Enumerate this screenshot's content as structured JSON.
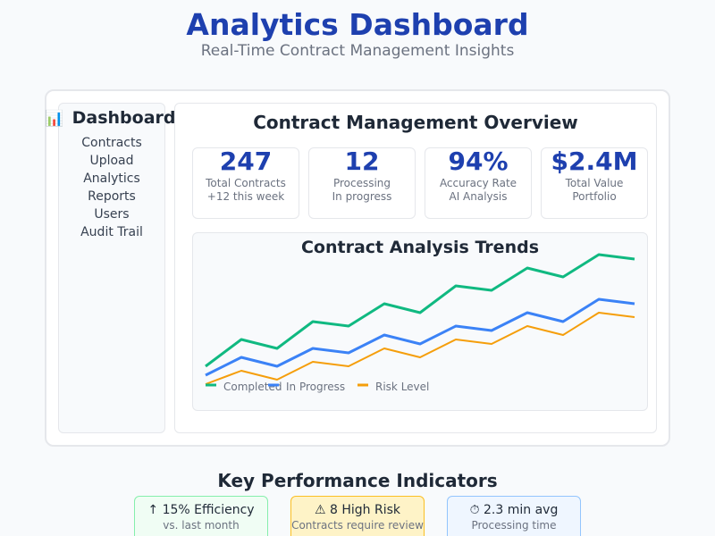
{
  "header": {
    "title": "Analytics Dashboard",
    "subtitle": "Real-Time Contract Management Insights"
  },
  "sidebar": {
    "title": "Dashboard",
    "title_icon": "📊",
    "items": [
      {
        "label": "Contracts"
      },
      {
        "label": "Upload"
      },
      {
        "label": "Analytics"
      },
      {
        "label": "Reports"
      },
      {
        "label": "Users"
      },
      {
        "label": "Audit Trail"
      }
    ]
  },
  "overview": {
    "title": "Contract Management Overview",
    "stats": [
      {
        "value": "247",
        "label": "Total Contracts",
        "sub": "+12 this week"
      },
      {
        "value": "12",
        "label": "Processing",
        "sub": "In progress"
      },
      {
        "value": "94%",
        "label": "Accuracy Rate",
        "sub": "AI Analysis"
      },
      {
        "value": "$2.4M",
        "label": "Total Value",
        "sub": "Portfolio"
      }
    ]
  },
  "chart_data": {
    "type": "line",
    "title": "Contract Analysis Trends",
    "xlabel": "",
    "ylabel": "",
    "grid": false,
    "legend_position": "bottom-left",
    "series": [
      {
        "name": "Completed",
        "color": "#10b981",
        "values": [
          10,
          40,
          30,
          60,
          55,
          80,
          70,
          100,
          95,
          120,
          110,
          135,
          130
        ]
      },
      {
        "name": "In Progress",
        "color": "#3b82f6",
        "values": [
          0,
          20,
          10,
          30,
          25,
          45,
          35,
          55,
          50,
          70,
          60,
          85,
          80
        ]
      },
      {
        "name": "Risk Level",
        "color": "#f59e0b",
        "values": [
          -10,
          5,
          -5,
          15,
          10,
          30,
          20,
          40,
          35,
          55,
          45,
          70,
          65
        ]
      }
    ]
  },
  "kpis": {
    "title": "Key Performance Indicators",
    "items": [
      {
        "main": "↑ 15% Efficiency",
        "sub": "vs. last month",
        "color": "#10b981"
      },
      {
        "main": "⚠ 8 High Risk",
        "sub": "Contracts require review",
        "color": "#f59e0b"
      },
      {
        "main": "⏱ 2.3 min avg",
        "sub": "Processing time",
        "color": "#3b82f6"
      }
    ]
  }
}
